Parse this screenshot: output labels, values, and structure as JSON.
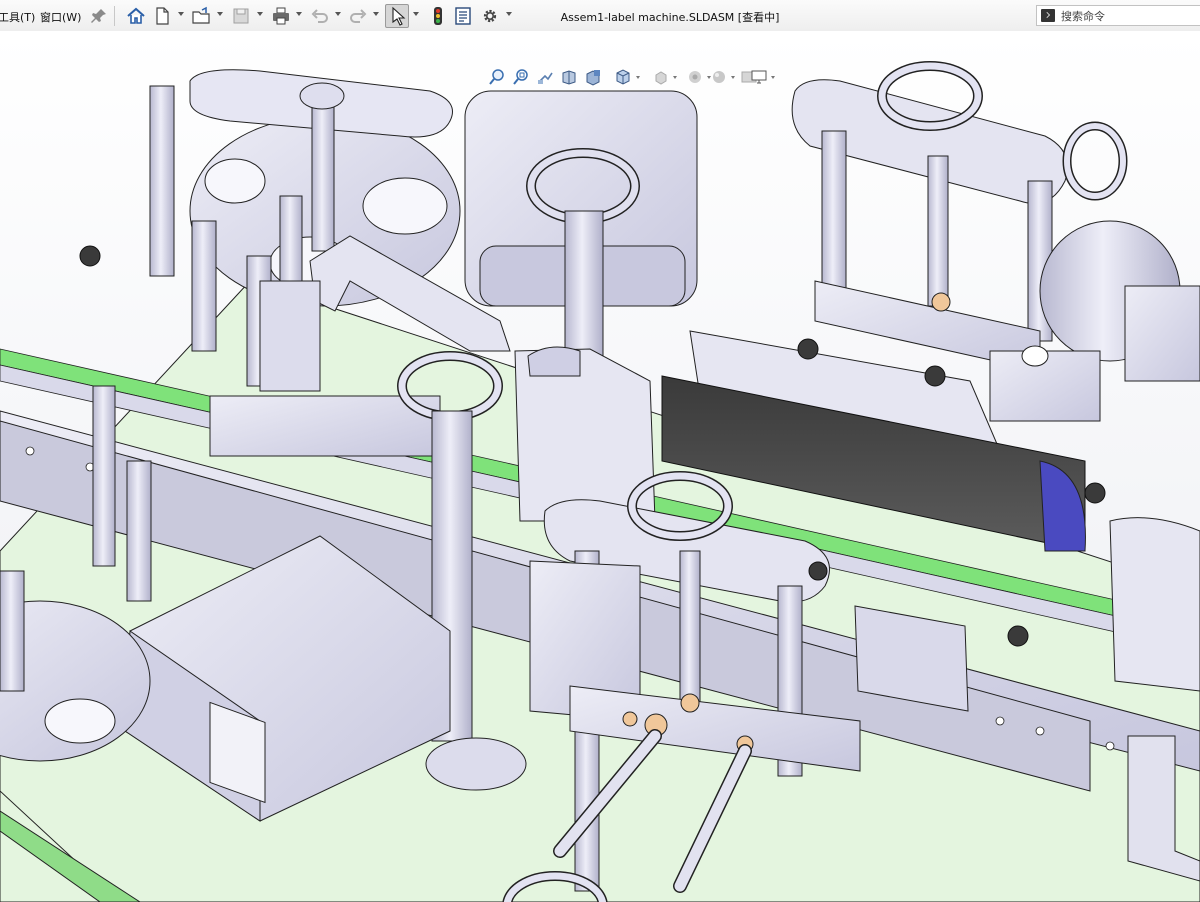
{
  "window": {
    "title": "Assem1-label machine.SLDASM [查看中]"
  },
  "menu": {
    "items": [
      {
        "id": "tools",
        "label": "工具(T)"
      },
      {
        "id": "window",
        "label": "窗口(W)"
      }
    ]
  },
  "toolbar": {
    "buttons": [
      {
        "id": "pin",
        "icon": "pin-icon"
      },
      {
        "id": "home",
        "icon": "home-icon"
      },
      {
        "id": "new",
        "icon": "new-document-icon"
      },
      {
        "id": "open",
        "icon": "open-folder-icon"
      },
      {
        "id": "save",
        "icon": "save-icon"
      },
      {
        "id": "print",
        "icon": "print-icon"
      },
      {
        "id": "undo",
        "icon": "undo-icon"
      },
      {
        "id": "redo",
        "icon": "redo-icon"
      },
      {
        "id": "select",
        "icon": "cursor-icon",
        "active": true
      },
      {
        "id": "traffic-light",
        "icon": "rebuild-icon"
      },
      {
        "id": "file-properties",
        "icon": "file-properties-icon"
      },
      {
        "id": "options",
        "icon": "gear-icon"
      }
    ]
  },
  "search": {
    "placeholder": "搜索命令"
  },
  "heads_up_toolbar": {
    "buttons": [
      {
        "id": "zoom-to-fit",
        "icon": "zoom-to-fit-icon"
      },
      {
        "id": "zoom-to-area",
        "icon": "zoom-to-area-icon"
      },
      {
        "id": "previous-view",
        "icon": "previous-view-icon"
      },
      {
        "id": "section-view",
        "icon": "section-view-icon"
      },
      {
        "id": "dynamic-annotation",
        "icon": "annotation-view-icon"
      },
      {
        "id": "view-orientation",
        "icon": "view-cube-icon"
      },
      {
        "id": "display-style",
        "icon": "display-style-icon"
      },
      {
        "id": "hide-show",
        "icon": "eye-icon"
      },
      {
        "id": "edit-appearance",
        "icon": "appearance-icon"
      },
      {
        "id": "apply-scene",
        "icon": "scene-icon"
      },
      {
        "id": "view-settings",
        "icon": "monitor-icon"
      }
    ]
  },
  "colors": {
    "part": "#dcdcec",
    "part_light": "#e8e8f4",
    "part_dark": "#b4b4cc",
    "edge": "#1a1a1a",
    "conveyor_green": "#7fe27a",
    "base_green": "#e6f6e2",
    "label_black": "#4a4a4a",
    "roller_blue": "#4a4ac0",
    "bushing_orange": "#f0c79a"
  }
}
